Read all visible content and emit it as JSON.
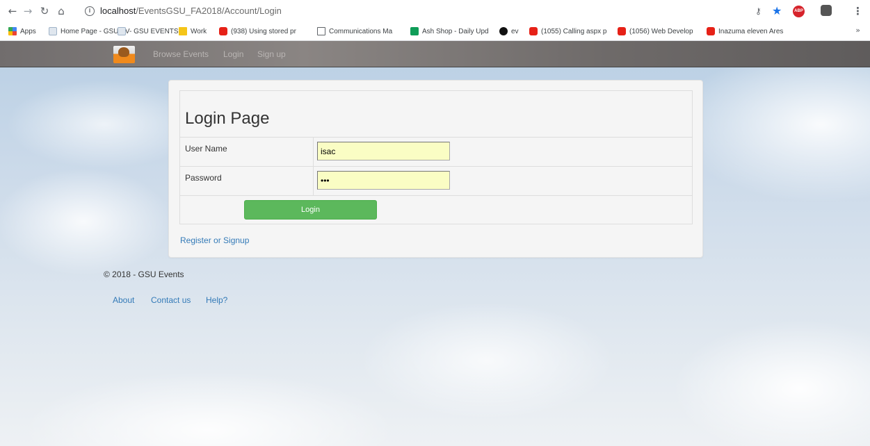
{
  "browser": {
    "url_host": "localhost",
    "url_path": "/EventsGSU_FA2018/Account/Login",
    "icons": {
      "back": "arrow-left-icon",
      "forward": "arrow-right-icon",
      "reload": "reload-icon",
      "home": "home-icon",
      "info": "info-icon",
      "key": "key-icon",
      "star": "star-icon",
      "adblock": "adblock-icon",
      "extension": "extension-icon",
      "menu": "kebab-menu-icon"
    },
    "bookmarks": [
      {
        "label": "Apps",
        "icon": "apps"
      },
      {
        "label": "Home Page - GSU EV",
        "icon": "page"
      },
      {
        "label": "- GSU EVENTS",
        "icon": "page"
      },
      {
        "label": "Work",
        "icon": "folder"
      },
      {
        "label": "(938) Using stored pr",
        "icon": "yt"
      },
      {
        "label": "Communications Ma",
        "icon": "doc"
      },
      {
        "label": "Ash Shop - Daily Upd",
        "icon": "sheet"
      },
      {
        "label": "ev",
        "icon": "gh"
      },
      {
        "label": "(1055) Calling aspx p",
        "icon": "yt"
      },
      {
        "label": "(1056) Web Develop",
        "icon": "yt"
      },
      {
        "label": "Inazuma eleven Ares",
        "icon": "yt"
      }
    ],
    "more_label": "»"
  },
  "navbar": {
    "logo": "gsu-logo",
    "links": [
      "Browse Events",
      "Login",
      "Sign up"
    ]
  },
  "login": {
    "title": "Login Page",
    "username_label": "User Name",
    "username_value": "isac",
    "password_label": "Password",
    "password_value": "abc",
    "button_label": "Login",
    "register_link": "Register or Signup"
  },
  "footer": {
    "copyright": "© 2018 - GSU Events",
    "links": [
      "About",
      "Contact us",
      "Help?"
    ]
  },
  "colors": {
    "navbar": "#7a7676",
    "panel": "#f5f5f5",
    "button": "#5cb85c",
    "link": "#337ab7",
    "input_autofill": "#fafdc4"
  }
}
